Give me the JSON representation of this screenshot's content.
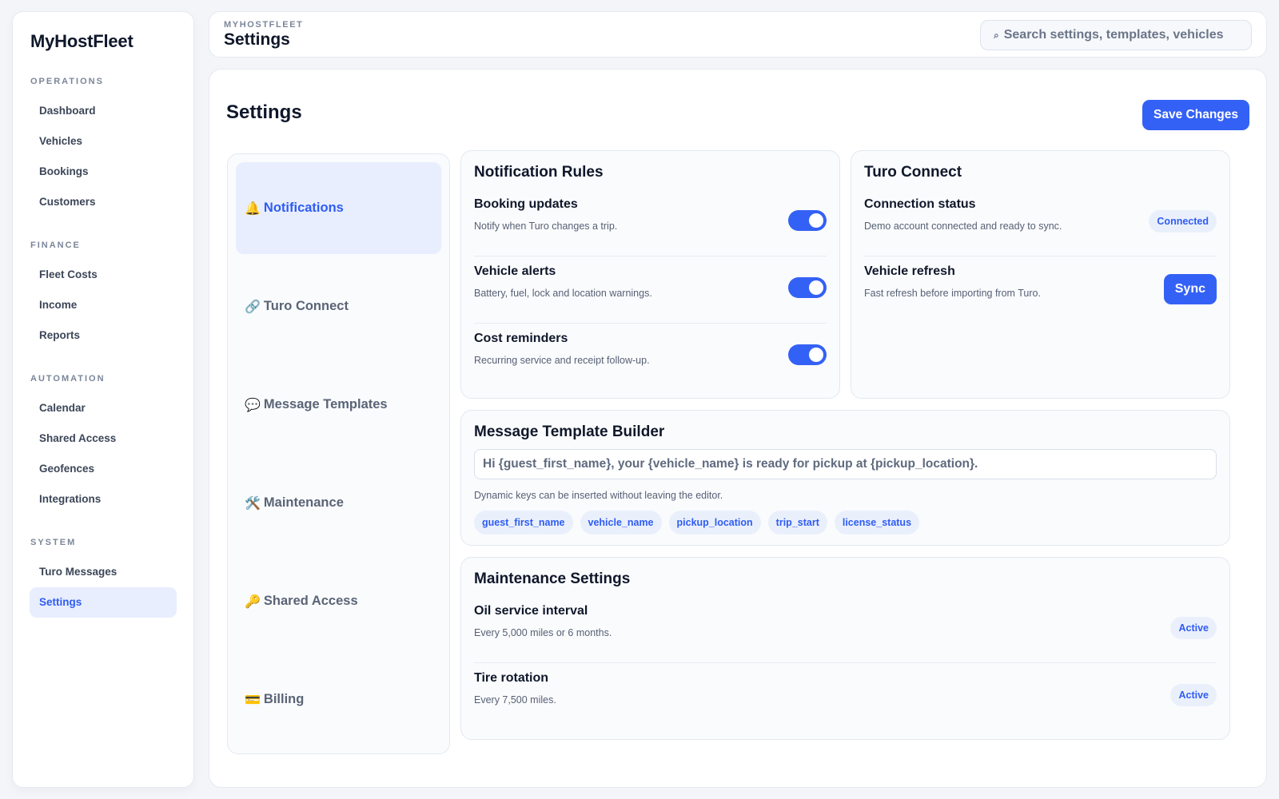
{
  "brand": "MyHostFleet",
  "sidebar": {
    "sections": [
      {
        "heading": "OPERATIONS",
        "items": [
          "Dashboard",
          "Vehicles",
          "Bookings",
          "Customers"
        ]
      },
      {
        "heading": "FINANCE",
        "items": [
          "Fleet Costs",
          "Income",
          "Reports"
        ]
      },
      {
        "heading": "AUTOMATION",
        "items": [
          "Calendar",
          "Shared Access",
          "Geofences",
          "Integrations"
        ]
      },
      {
        "heading": "SYSTEM",
        "items": [
          "Turo Messages",
          "Settings"
        ]
      }
    ],
    "active": "Settings"
  },
  "header": {
    "breadcrumb": "MYHOSTFLEET",
    "title": "Settings",
    "search_placeholder": "Search settings, templates, vehicles"
  },
  "main": {
    "title": "Settings",
    "save_label": "Save Changes"
  },
  "settings_nav": [
    {
      "icon": "🔔",
      "label": "Notifications",
      "active": true
    },
    {
      "icon": "🔗",
      "label": "Turo Connect",
      "active": false
    },
    {
      "icon": "💬",
      "label": "Message Templates",
      "active": false
    },
    {
      "icon": "🛠️",
      "label": "Maintenance",
      "active": false
    },
    {
      "icon": "🔑",
      "label": "Shared Access",
      "active": false
    },
    {
      "icon": "💳",
      "label": "Billing",
      "active": false
    }
  ],
  "notification_rules": {
    "title": "Notification Rules",
    "rows": [
      {
        "title": "Booking updates",
        "desc": "Notify when Turo changes a trip.",
        "enabled": true
      },
      {
        "title": "Vehicle alerts",
        "desc": "Battery, fuel, lock and location warnings.",
        "enabled": true
      },
      {
        "title": "Cost reminders",
        "desc": "Recurring service and receipt follow-up.",
        "enabled": true
      }
    ]
  },
  "turo_connect": {
    "title": "Turo Connect",
    "status_title": "Connection status",
    "status_desc": "Demo account connected and ready to sync.",
    "status_badge": "Connected",
    "refresh_title": "Vehicle refresh",
    "refresh_desc": "Fast refresh before importing from Turo.",
    "sync_label": "Sync"
  },
  "template_builder": {
    "title": "Message Template Builder",
    "value": "Hi {guest_first_name}, your {vehicle_name} is ready for pickup at {pickup_location}.",
    "help": "Dynamic keys can be inserted without leaving the editor.",
    "keys": [
      "guest_first_name",
      "vehicle_name",
      "pickup_location",
      "trip_start",
      "license_status"
    ]
  },
  "maintenance": {
    "title": "Maintenance Settings",
    "rows": [
      {
        "title": "Oil service interval",
        "desc": "Every 5,000 miles or 6 months.",
        "badge": "Active"
      },
      {
        "title": "Tire rotation",
        "desc": "Every 7,500 miles.",
        "badge": "Active"
      }
    ]
  },
  "colors": {
    "accent": "#3461f5",
    "accent_soft": "#e8eefd"
  }
}
